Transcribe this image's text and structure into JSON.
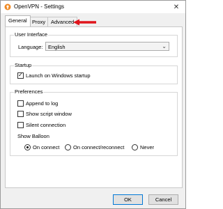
{
  "window": {
    "title": "OpenVPN - Settings",
    "close_glyph": "✕"
  },
  "tabs": [
    {
      "label": "General",
      "active": true
    },
    {
      "label": "Proxy",
      "active": false
    },
    {
      "label": "Advanced",
      "active": false
    }
  ],
  "annotation": {
    "arrow_color": "#e0151c"
  },
  "user_interface": {
    "group_label": "User Interface",
    "language_label": "Language:",
    "language_value": "English"
  },
  "startup": {
    "group_label": "Startup",
    "launch_label": "Launch on Windows startup",
    "launch_checked": true
  },
  "preferences": {
    "group_label": "Preferences",
    "append_log_label": "Append to log",
    "append_log_checked": false,
    "show_script_label": "Show script window",
    "show_script_checked": false,
    "silent_label": "Silent connection",
    "silent_checked": false,
    "show_balloon_label": "Show Balloon",
    "balloon_options": [
      {
        "label": "On connect",
        "selected": true
      },
      {
        "label": "On connect/reconnect",
        "selected": false
      },
      {
        "label": "Never",
        "selected": false
      }
    ]
  },
  "buttons": {
    "ok_label": "OK",
    "cancel_label": "Cancel"
  },
  "icons": {
    "app": "openvpn-icon",
    "close": "close-icon",
    "dropdown": "chevron-down-icon",
    "annotation": "red-arrow-icon"
  }
}
